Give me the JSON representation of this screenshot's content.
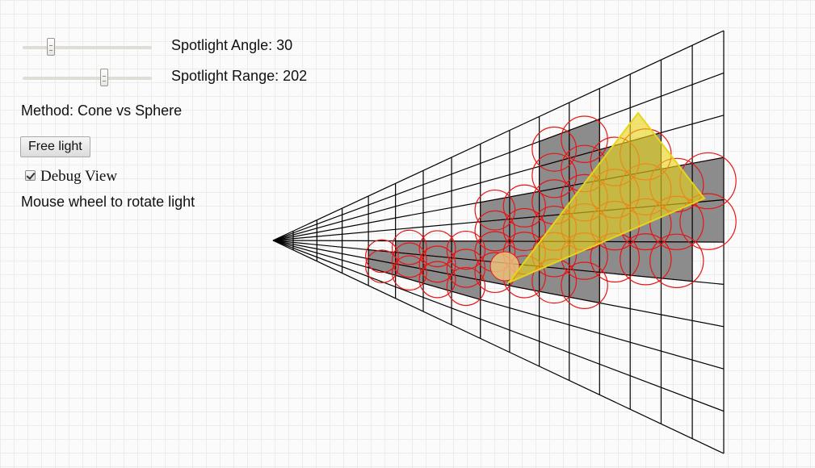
{
  "controls": {
    "angle": {
      "label": "Spotlight Angle: 30",
      "value": 30,
      "fraction": 0.2
    },
    "range": {
      "label": "Spotlight Range: 202",
      "value": 202,
      "fraction": 0.64
    },
    "method_label": "Method: Cone vs Sphere",
    "free_light_button": "Free light",
    "debug_view": {
      "label": "Debug View",
      "checked": true
    },
    "hint": "Mouse wheel to rotate light"
  },
  "scene": {
    "grid_color": "#000000",
    "sphere_color": "#e81414",
    "highlight_cell_color": "#8c8c8c",
    "cone_color": "#e8d41a",
    "light_origin_color": "#f2c47a",
    "depth_slices": 16,
    "radial_rays": 10,
    "highlighted_cells": [
      [
        10,
        1
      ],
      [
        11,
        1
      ],
      [
        10,
        2
      ],
      [
        11,
        2
      ],
      [
        12,
        2
      ],
      [
        13,
        2
      ],
      [
        8,
        3
      ],
      [
        9,
        3
      ],
      [
        10,
        3
      ],
      [
        11,
        3
      ],
      [
        12,
        3
      ],
      [
        13,
        3
      ],
      [
        14,
        3
      ],
      [
        15,
        3
      ],
      [
        8,
        4
      ],
      [
        9,
        4
      ],
      [
        10,
        4
      ],
      [
        11,
        4
      ],
      [
        12,
        4
      ],
      [
        13,
        4
      ],
      [
        14,
        4
      ],
      [
        15,
        4
      ],
      [
        5,
        5
      ],
      [
        6,
        5
      ],
      [
        7,
        5
      ],
      [
        8,
        5
      ],
      [
        9,
        5
      ],
      [
        10,
        5
      ],
      [
        11,
        5
      ],
      [
        12,
        5
      ],
      [
        13,
        5
      ],
      [
        14,
        5
      ],
      [
        4,
        6
      ],
      [
        5,
        6
      ],
      [
        6,
        6
      ],
      [
        7,
        6
      ],
      [
        8,
        6
      ],
      [
        9,
        6
      ],
      [
        10,
        6
      ],
      [
        11,
        6
      ],
      [
        4,
        7
      ],
      [
        5,
        7
      ],
      [
        6,
        7
      ],
      [
        7,
        7
      ]
    ]
  }
}
